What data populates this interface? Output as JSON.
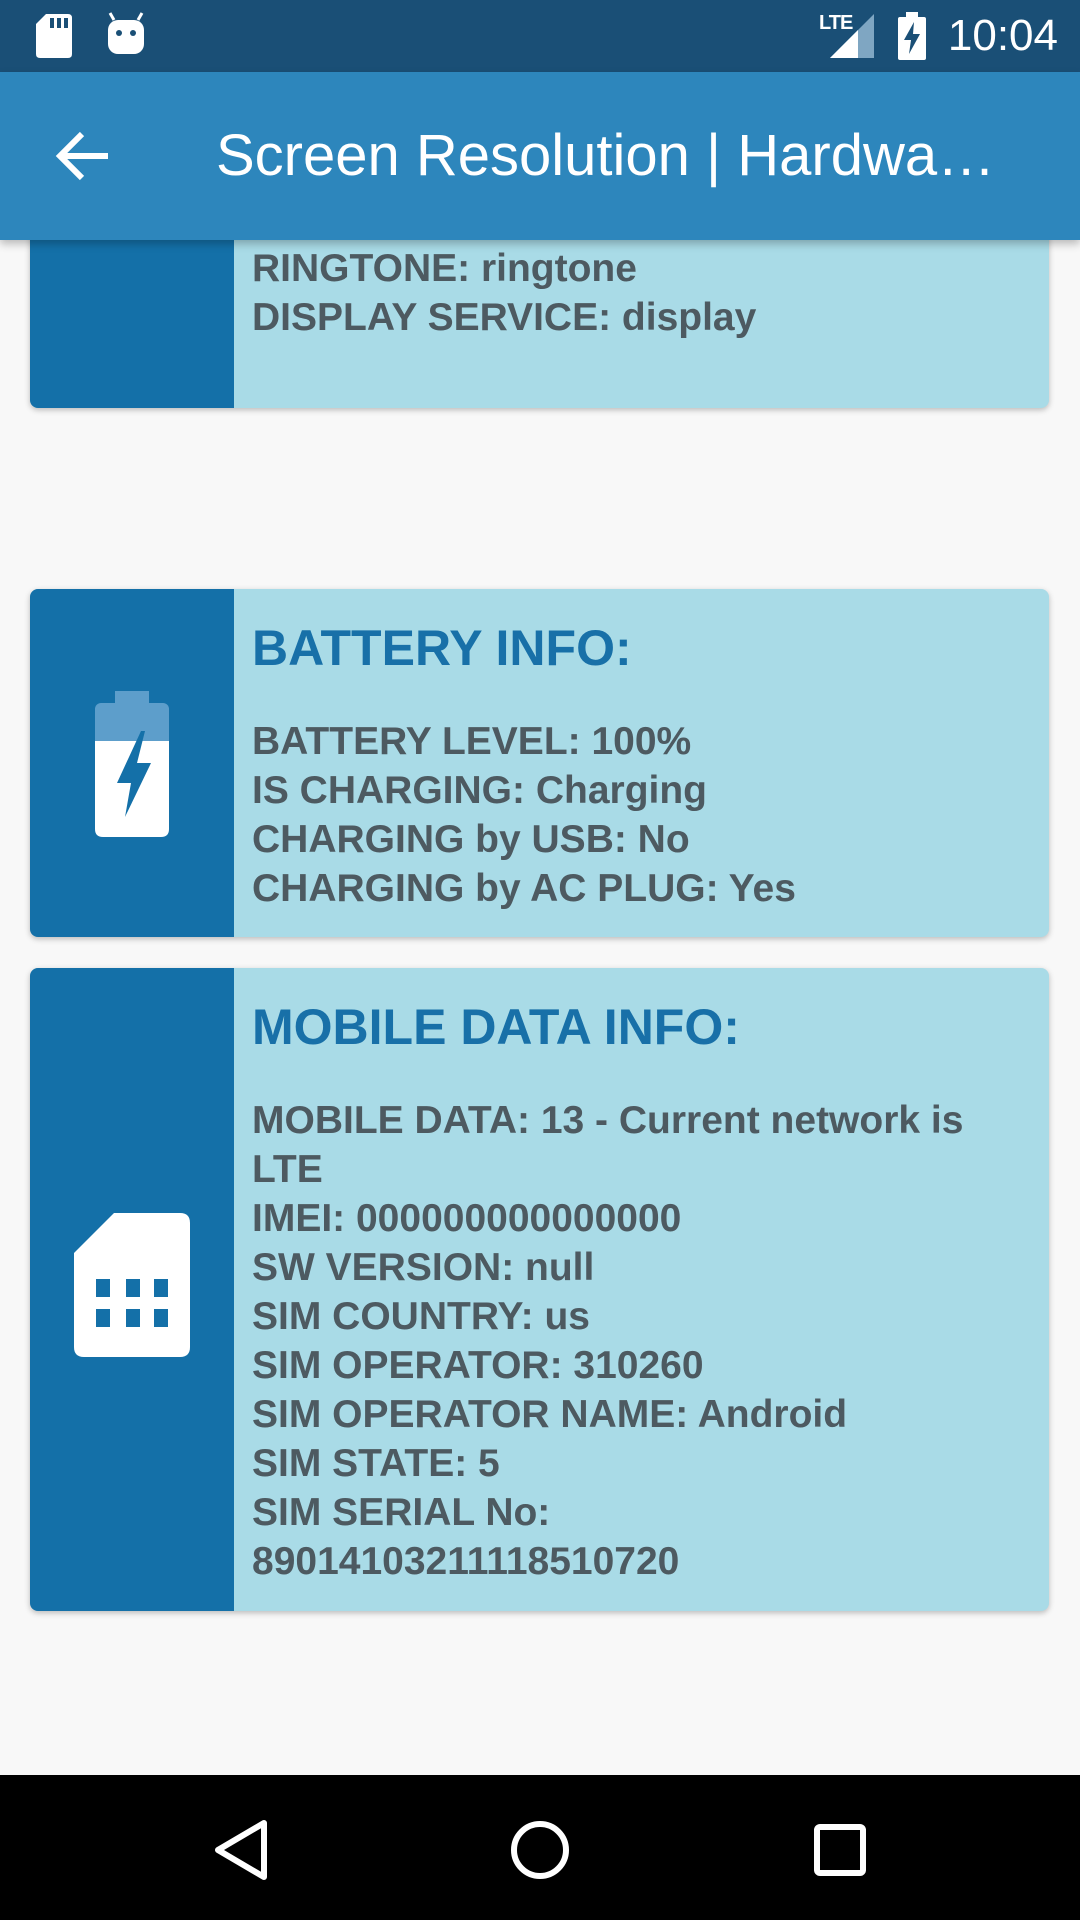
{
  "status_bar": {
    "time": "10:04",
    "network_label": "LTE",
    "icons": [
      "sd-card-icon",
      "android-icon",
      "lte-signal-icon",
      "battery-charging-icon"
    ]
  },
  "app_bar": {
    "title": "Screen Resolution | Hardwa…",
    "back_icon": "arrow-back-icon"
  },
  "cards": {
    "top": {
      "lines": [
        "RINGTONE: ringtone",
        "DISPLAY SERVICE: display"
      ]
    },
    "battery": {
      "icon": "battery-charging-icon",
      "heading": "BATTERY INFO:",
      "lines": [
        "BATTERY LEVEL: 100%",
        "IS CHARGING: Charging",
        "CHARGING by USB: No",
        "CHARGING by AC PLUG: Yes"
      ]
    },
    "mobile": {
      "icon": "sim-card-icon",
      "heading": "MOBILE DATA INFO:",
      "lines": [
        "MOBILE DATA: 13 - Current network is LTE",
        "IMEI: 000000000000000",
        "SW VERSION: null",
        "SIM COUNTRY: us",
        "SIM OPERATOR: 310260",
        "SIM OPERATOR NAME: Android",
        "SIM STATE: 5",
        "SIM SERIAL No: 89014103211118510720"
      ]
    }
  },
  "nav_bar": {
    "buttons": [
      "back-triangle-icon",
      "home-circle-icon",
      "recents-square-icon"
    ]
  },
  "colors": {
    "status_bar": "#1a4f76",
    "app_bar": "#2d86bc",
    "card_bg": "#a9dbe7",
    "card_side": "#1470a8",
    "heading": "#1870a8",
    "text": "#4d5a61"
  }
}
